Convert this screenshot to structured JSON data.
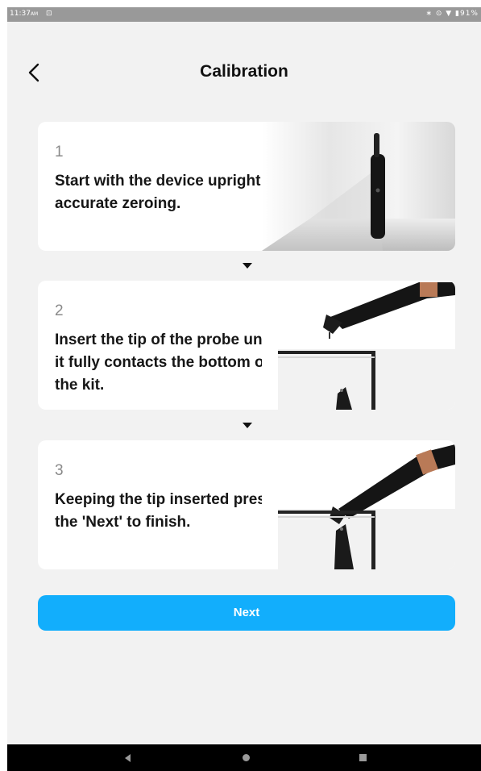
{
  "status_bar": {
    "time": "11:37",
    "ampm": "AM",
    "notification_icon": "screen-mirror-icon",
    "right_icons": "∗ ⊙ ▼ ▮",
    "battery": "91%"
  },
  "header": {
    "title": "Calibration",
    "back_icon": "chevron-left-icon"
  },
  "steps": [
    {
      "number": "1",
      "text": "Start with the device upright for accurate zeroing.",
      "image": "device-upright-image"
    },
    {
      "number": "2",
      "text": "Insert the tip of the probe until it fully contacts the bottom of the kit.",
      "image": "probe-insert-image"
    },
    {
      "number": "3",
      "text": "Keeping the tip inserted press the 'Next' to finish.",
      "image": "probe-inserted-image"
    }
  ],
  "next_button": {
    "label": "Next",
    "color": "#12aefc"
  },
  "nav_bar": {
    "back_icon": "nav-back-icon",
    "home_icon": "nav-home-icon",
    "recents_icon": "nav-recents-icon"
  }
}
